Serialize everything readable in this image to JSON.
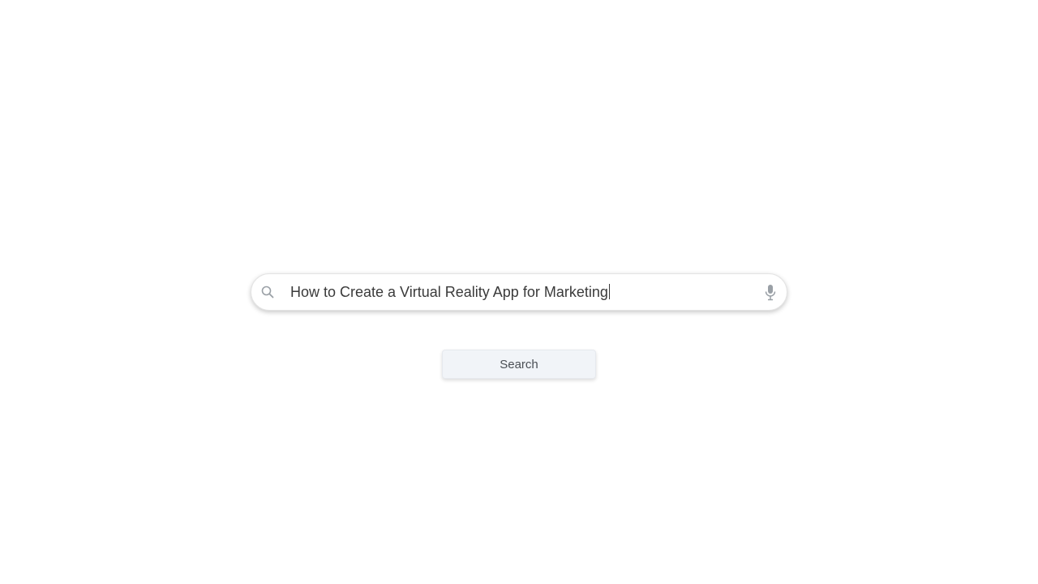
{
  "search": {
    "query": "How to Create a Virtual Reality App for Marketing",
    "icon_left": "search-icon",
    "icon_right": "microphone-icon"
  },
  "actions": {
    "search_button_label": "Search"
  },
  "colors": {
    "background": "#ffffff",
    "text": "#3a3a3a",
    "icon": "#9aa0a6",
    "button_bg": "#f1f4f8"
  }
}
